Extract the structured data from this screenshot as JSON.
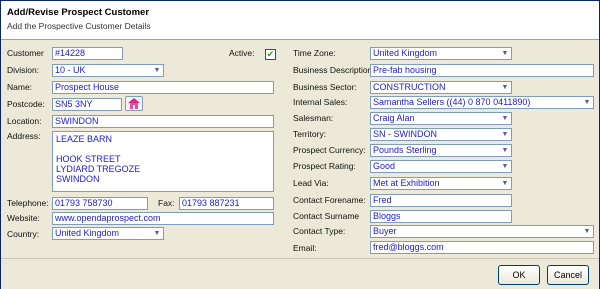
{
  "header": {
    "title": "Add/Revise Prospect Customer",
    "subtitle": "Add the Prospective Customer Details"
  },
  "left": {
    "customer_label": "Customer",
    "customer_value": "#14228",
    "active_label": "Active:",
    "active_checked": true,
    "division_label": "Division:",
    "division_value": "10 - UK",
    "name_label": "Name:",
    "name_value": "Prospect House",
    "postcode_label": "Postcode:",
    "postcode_value": "SN5 3NY",
    "location_label": "Location:",
    "location_value": "SWINDON",
    "address_label": "Address:",
    "address_value": "LEAZE BARN\n\nHOOK STREET\nLYDIARD TREGOZE\nSWINDON",
    "telephone_label": "Telephone:",
    "telephone_value": "01793 758730",
    "fax_label": "Fax:",
    "fax_value": "01793 887231",
    "website_label": "Website:",
    "website_value": "www.opendaprospect.com",
    "country_label": "Country:",
    "country_value": "United Kingdom"
  },
  "right": {
    "timezone_label": "Time Zone:",
    "timezone_value": "United Kingdom",
    "bizdesc_label": "Business Description:",
    "bizdesc_value": "Pre-fab housing",
    "sector_label": "Business Sector:",
    "sector_value": "CONSTRUCTION",
    "internal_label": "Internal Sales:",
    "internal_value": "Samantha Sellers ((44) 0 870 0411890)",
    "salesman_label": "Salesman:",
    "salesman_value": "Craig Alan",
    "territory_label": "Territory:",
    "territory_value": "SN - SWINDON",
    "currency_label": "Prospect Currency:",
    "currency_value": "Pounds Sterling",
    "rating_label": "Prospect Rating:",
    "rating_value": "Good",
    "leadvia_label": "Lead Via:",
    "leadvia_value": "Met at Exhibition",
    "forename_label": "Contact Forename:",
    "forename_value": "Fred",
    "surname_label": "Contact Surname",
    "surname_value": "Bloggs",
    "contacttype_label": "Contact Type:",
    "contacttype_value": "Buyer",
    "email_label": "Email:",
    "email_value": "fred@bloggs.com"
  },
  "footer": {
    "ok_label": "OK",
    "cancel_label": "Cancel"
  },
  "icons": {
    "dropdown": "chevron-down-icon",
    "postcode_lookup": "home-icon",
    "active_check": "checkmark-icon"
  }
}
